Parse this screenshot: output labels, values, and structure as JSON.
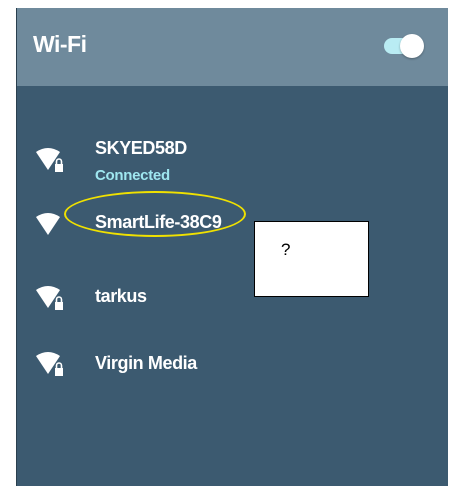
{
  "header": {
    "title": "Wi-Fi",
    "toggle_on": true
  },
  "networks": [
    {
      "name": "SKYED58D",
      "status": "Connected",
      "secured": true,
      "signal_icon": "wifi-lock-icon"
    },
    {
      "name": "SmartLife-38C9",
      "status": "",
      "secured": false,
      "signal_icon": "wifi-icon"
    },
    {
      "name": "tarkus",
      "status": "",
      "secured": true,
      "signal_icon": "wifi-lock-icon"
    },
    {
      "name": "Virgin Media",
      "status": "",
      "secured": true,
      "signal_icon": "wifi-lock-icon"
    }
  ],
  "annotation": {
    "callout_text": "?",
    "highlighted_network": "SmartLife-38C9",
    "ring_color": "#f0e100"
  },
  "colors": {
    "panel_bg": "#3c5a70",
    "header_bg": "#6f8a9c",
    "connected_text": "#9fe7f0",
    "toggle_track": "#b9ecf3"
  }
}
